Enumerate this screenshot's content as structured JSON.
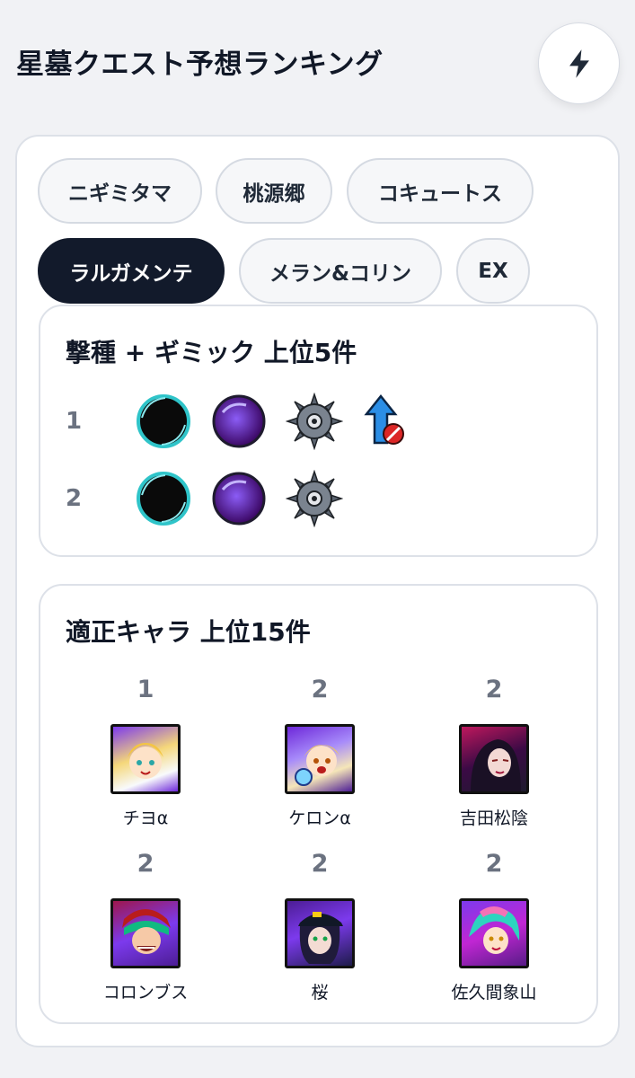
{
  "header": {
    "title": "星墓クエスト予想ランキング",
    "action_icon": "bolt-icon"
  },
  "tabs": [
    {
      "label": "ニギミタマ",
      "active": false
    },
    {
      "label": "桃源郷",
      "active": false
    },
    {
      "label": "コキュートス",
      "active": false
    },
    {
      "label": "ラルガメンテ",
      "active": true
    },
    {
      "label": "メラン&コリン",
      "active": false
    },
    {
      "label": "EX",
      "active": false
    }
  ],
  "gimmick_panel": {
    "title": "撃種 + ギミック 上位5件",
    "rows": [
      {
        "rank": "1",
        "icons": [
          "black-hole-icon",
          "purple-orb-icon",
          "spiked-mine-icon",
          "speed-up-blocked-icon"
        ]
      },
      {
        "rank": "2",
        "icons": [
          "black-hole-icon",
          "purple-orb-icon",
          "spiked-mine-icon"
        ]
      }
    ]
  },
  "character_panel": {
    "title": "適正キャラ 上位15件",
    "characters": [
      {
        "rank": "1",
        "name": "チヨα",
        "portrait": "blonde-girl-portrait"
      },
      {
        "rank": "2",
        "name": "ケロンα",
        "portrait": "blonde-boy-portrait"
      },
      {
        "rank": "2",
        "name": "吉田松陰",
        "portrait": "dark-hair-portrait"
      },
      {
        "rank": "2",
        "name": "コロンブス",
        "portrait": "green-hair-portrait"
      },
      {
        "rank": "2",
        "name": "桜",
        "portrait": "cap-girl-portrait"
      },
      {
        "rank": "2",
        "name": "佐久間象山",
        "portrait": "teal-hair-portrait"
      }
    ]
  },
  "colors": {
    "active_tab": "#121a2b",
    "attribute_purple": "#6d28d9",
    "rank_gray": "#6b7280"
  }
}
